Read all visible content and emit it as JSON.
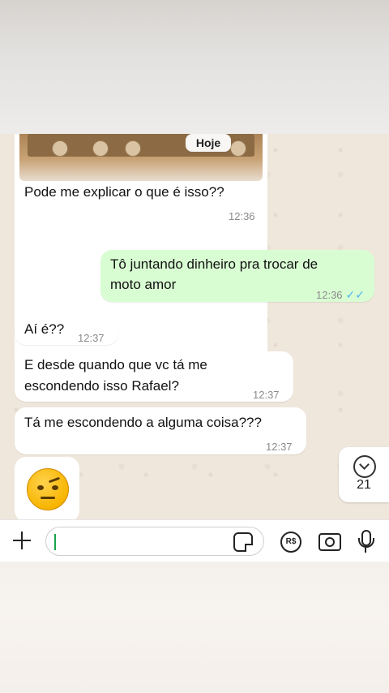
{
  "chat": {
    "photo_bubble": {
      "date_chip": "Hoje",
      "text": "Pode me explicar o que é isso??",
      "time": "12:36"
    },
    "out_message": {
      "text_line1": "Tô juntando dinheiro pra trocar de",
      "text_line2": "moto amor",
      "time": "12:36",
      "status": "read"
    },
    "incoming": [
      {
        "text": "Aí é??",
        "time": "12:37"
      },
      {
        "text_line1": "E desde quando que vc tá me",
        "text_line2": "escondendo isso Rafael?",
        "time": "12:37"
      },
      {
        "text": "Tá me escondendo a alguma coisa???",
        "time": "12:37"
      }
    ],
    "emoji_message": {
      "emoji": "face-with-raised-eyebrow"
    },
    "scroll_to_bottom": {
      "unread_count": "21"
    }
  },
  "composer": {
    "input_value": "",
    "icons": [
      "plus-icon",
      "sticker-icon",
      "rs-payment-icon",
      "camera-icon",
      "microphone-icon"
    ]
  },
  "colors": {
    "incoming_bubble": "#ffffff",
    "outgoing_bubble": "#d9fdd3",
    "read_ticks": "#4fb6ec",
    "chat_background": "#efe6dc"
  }
}
